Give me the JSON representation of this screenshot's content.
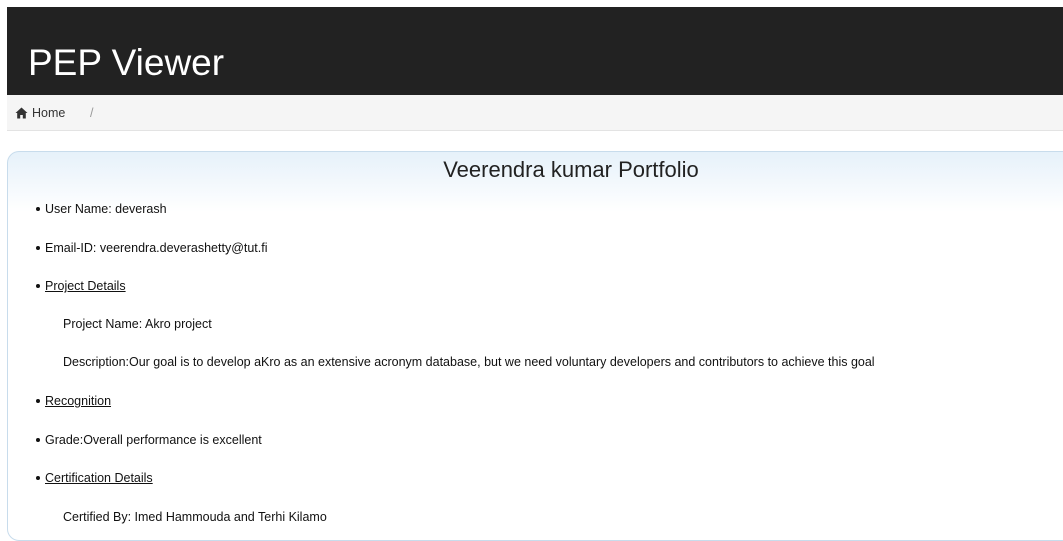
{
  "app": {
    "title": "PEP Viewer"
  },
  "breadcrumb": {
    "home_label": "Home",
    "separator": "/",
    "home_icon": "home-icon"
  },
  "portfolio": {
    "title": "Veerendra kumar Portfolio",
    "user_name": "User Name: deverash",
    "email": "Email-ID: veerendra.deverashetty@tut.fi",
    "project_details_link": "Project Details",
    "project_name": "Project Name: Akro project",
    "description": "Description:Our goal is to develop aKro as an extensive acronym database, but we need voluntary developers and contributors to achieve this goal",
    "recognition_link": "Recognition",
    "grade": "Grade:Overall performance is excellent",
    "certification_link": "Certification Details",
    "certified_by": "Certified By: Imed Hammouda and Terhi Kilamo"
  }
}
